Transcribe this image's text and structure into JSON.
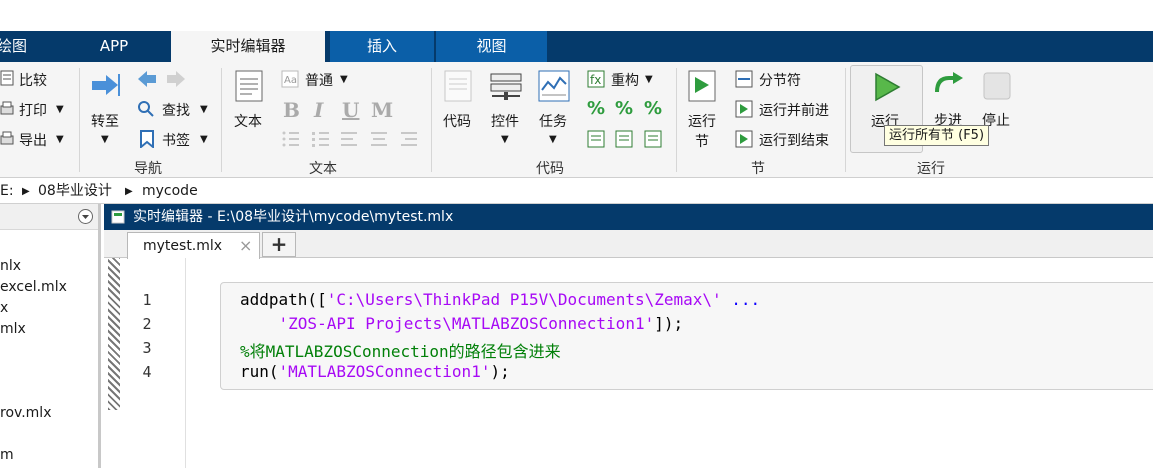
{
  "tabs": {
    "t0": "绘图",
    "t1": "APP",
    "t2": "实时编辑器",
    "t3": "插入",
    "t4": "视图"
  },
  "ribbon": {
    "nav": {
      "compare": "比较",
      "print": "打印",
      "export": "导出",
      "goto": "转至",
      "find": "查找",
      "bookmark": "书签",
      "label": "导航"
    },
    "text": {
      "text_btn": "文本",
      "style": "普通",
      "bold": "B",
      "italic": "I",
      "underline": "U",
      "mono": "M",
      "label": "文本"
    },
    "code": {
      "code_btn": "代码",
      "control": "控件",
      "task": "任务",
      "refactor": "重构",
      "label": "代码"
    },
    "section": {
      "run_section_1": "运行",
      "run_section_2": "节",
      "section_break": "分节符",
      "run_advance": "运行并前进",
      "run_to_end": "运行到结束",
      "label": "节"
    },
    "run": {
      "run": "运行",
      "step": "步进",
      "stop": "停止",
      "label": "运行",
      "tooltip": "运行所有节 (F5)"
    }
  },
  "address": {
    "drive": "E:",
    "folder": "08毕业设计",
    "sub": "mycode"
  },
  "sidebar": {
    "items": [
      "nlx",
      "excel.mlx",
      "x",
      "mlx",
      "rov.mlx",
      "m"
    ]
  },
  "editor": {
    "title": "实时编辑器 - E:\\08毕业设计\\mycode\\mytest.mlx",
    "tab": "mytest.mlx",
    "tab_close": "×",
    "add_tab": "+",
    "lines": [
      "1",
      "2",
      "3",
      "4"
    ],
    "code": {
      "l1_a": "addpath([",
      "l1_str": "'C:\\Users\\ThinkPad P15V\\Documents\\Zemax\\'",
      "l1_cont": " ...",
      "l2_str": "    'ZOS-API Projects\\MATLABZOSConnection1'",
      "l2_b": "]);",
      "l3": "%将MATLABZOSConnection的路径包含进来",
      "l4_a": "run(",
      "l4_str": "'MATLABZOSConnection1'",
      "l4_b": ");"
    }
  }
}
